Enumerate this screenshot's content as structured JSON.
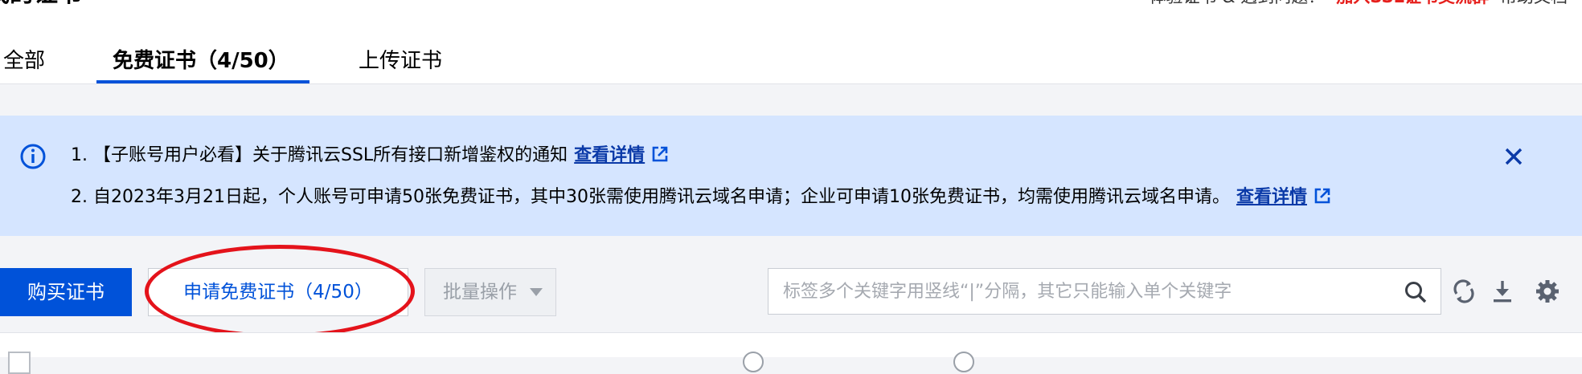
{
  "header": {
    "page_title": "我的证书",
    "top_right": {
      "prefix": "体验证书 & 遇到问题？",
      "group_link": "加入SSL证书交流群",
      "docs": "帮助文档"
    }
  },
  "tabs": [
    {
      "label": "全部",
      "active": false
    },
    {
      "label": "免费证书（4/50）",
      "active": true
    },
    {
      "label": "上传证书",
      "active": false
    }
  ],
  "notice": {
    "line1": "1. 【子账号用户必看】关于腾讯云SSL所有接口新增鉴权的通知",
    "line1_link": "查看详情",
    "line2": "2. 自2023年3月21日起，个人账号可申请50张免费证书，其中30张需使用腾讯云域名申请；企业可申请10张免费证书，均需使用腾讯云域名申请。",
    "line2_link": "查看详情"
  },
  "toolbar": {
    "buy_label": "购买证书",
    "apply_free_label": "申请免费证书（4/50）",
    "batch_label": "批量操作",
    "search_placeholder": "标签多个关键字用竖线“|”分隔，其它只能输入单个关键字"
  },
  "icons": {
    "info": "info-circle-icon",
    "close": "close-icon",
    "external": "external-link-icon",
    "search": "search-icon",
    "refresh": "refresh-icon",
    "download": "download-icon",
    "settings": "gear-icon"
  },
  "colors": {
    "primary": "#0052d9",
    "notice_bg": "#d5e5ff",
    "highlight_ring": "#e4131b",
    "link_red": "#e6201d"
  }
}
